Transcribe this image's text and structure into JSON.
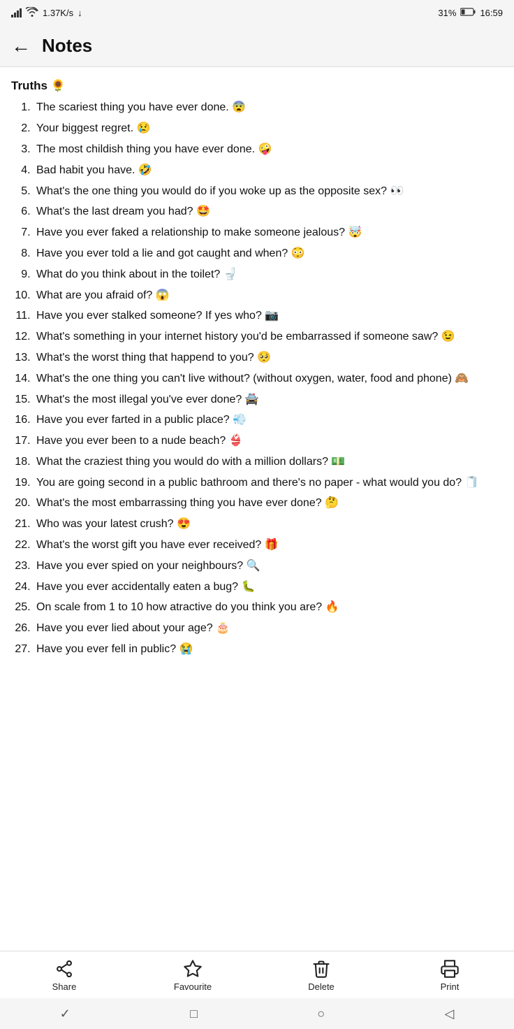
{
  "statusBar": {
    "signal": "signal",
    "speed": "1.37K/s",
    "download": "↓",
    "battery": "31%",
    "time": "16:59"
  },
  "header": {
    "back_label": "←",
    "title": "Notes"
  },
  "content": {
    "section_title": "Truths 🌻",
    "questions": [
      "The scariest thing you have ever done. 😨",
      "Your biggest regret. 😢",
      "The most childish thing you have ever done. 🤪",
      "Bad habit you have. 🤣",
      "What's the one thing you would do if you woke up as the opposite sex? 👀",
      "What's the last dream you had? 🤩",
      "Have you ever faked a relationship to make someone jealous? 🤯",
      "Have you ever told a lie and got caught and when? 😳",
      "What do you think about in the toilet? 🚽",
      "What are you afraid of? 😱",
      "Have you ever stalked someone? If yes who? 📷",
      "What's something in your internet history you'd be embarrassed if someone saw? 😉",
      "What's the worst thing that happend to you? 🥺",
      "What's the one thing you can't live without? (without oxygen, water, food and phone) 🙈",
      "What's the most illegal you've ever done? 🚔",
      "Have you ever farted in a public place? 💨",
      "Have you ever been to a nude beach? 👙",
      "What the craziest thing you would do with a million dollars? 💵",
      "You are going second in a public bathroom and there's no paper - what would you do? 🧻",
      "What's the most embarrassing thing you have ever done? 🤔",
      "Who was your latest crush? 😍",
      "What's the worst gift you have ever received? 🎁",
      "Have you ever spied on your neighbours? 🔍",
      "Have you ever accidentally eaten a bug? 🐛",
      "On scale from 1 to 10 how atractive do you think you are? 🔥",
      "Have you ever lied about your age? 🎂",
      "Have you ever fell in public? 😭"
    ]
  },
  "bottomBar": {
    "actions": [
      {
        "id": "share",
        "label": "Share",
        "icon": "share"
      },
      {
        "id": "favourite",
        "label": "Favourite",
        "icon": "star"
      },
      {
        "id": "delete",
        "label": "Delete",
        "icon": "trash"
      },
      {
        "id": "print",
        "label": "Print",
        "icon": "print"
      }
    ]
  },
  "navBar": {
    "back": "‹",
    "home": "□",
    "circle": "○",
    "forward": "▷"
  }
}
